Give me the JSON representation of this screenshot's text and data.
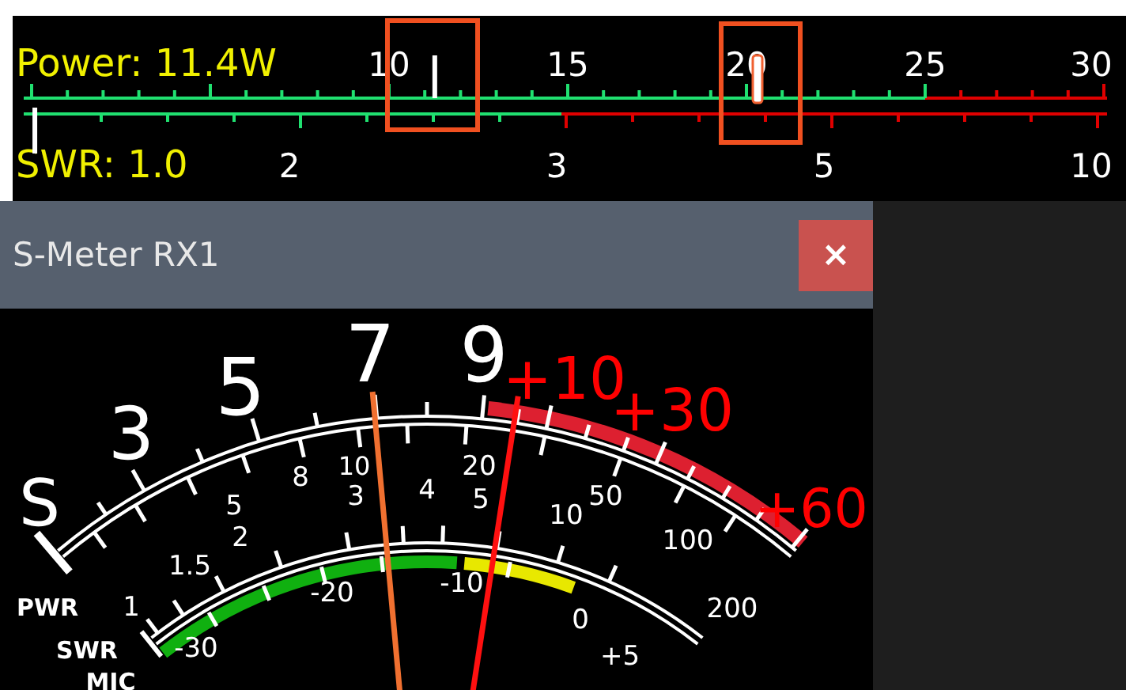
{
  "power_meter": {
    "label": "Power: 11.4W",
    "scale_labels": [
      "10",
      "15",
      "20",
      "25",
      "30"
    ],
    "markers": [
      {
        "kind": "needle",
        "level": 0.376
      },
      {
        "kind": "peak",
        "level": 0.677
      }
    ]
  },
  "swr_meter": {
    "label": "SWR: 1.0",
    "scale_labels": [
      "2",
      "3",
      "5",
      "10"
    ],
    "markers": [
      {
        "kind": "needle",
        "level": 0.003
      }
    ]
  },
  "s_meter_window": {
    "title": "S-Meter RX1",
    "close_button": "×",
    "s_scale": [
      {
        "text": "S",
        "color": "#ffffff"
      },
      {
        "text": "3",
        "color": "#ffffff"
      },
      {
        "text": "5",
        "color": "#ffffff"
      },
      {
        "text": "7",
        "color": "#ffffff"
      },
      {
        "text": "9",
        "color": "#ffffff"
      },
      {
        "text": "+10",
        "color": "#ff0000"
      },
      {
        "text": "+30",
        "color": "#ff0000"
      },
      {
        "text": "+60",
        "color": "#ff0000"
      }
    ],
    "pwr_scale": [
      "5",
      "8",
      "10",
      "20",
      "50",
      "100",
      "200"
    ],
    "swr_scale": [
      "1",
      "1.5",
      "2",
      "3",
      "4",
      "5",
      "10"
    ],
    "mic_scale": [
      "-30",
      "-20",
      "-10",
      "0",
      "+5"
    ],
    "scale_names": [
      "PWR",
      "SWR",
      "MIC"
    ],
    "needles": [
      {
        "color": "#f07030",
        "level": 0.435
      },
      {
        "color": "#ff1010",
        "level": 0.609
      }
    ]
  }
}
